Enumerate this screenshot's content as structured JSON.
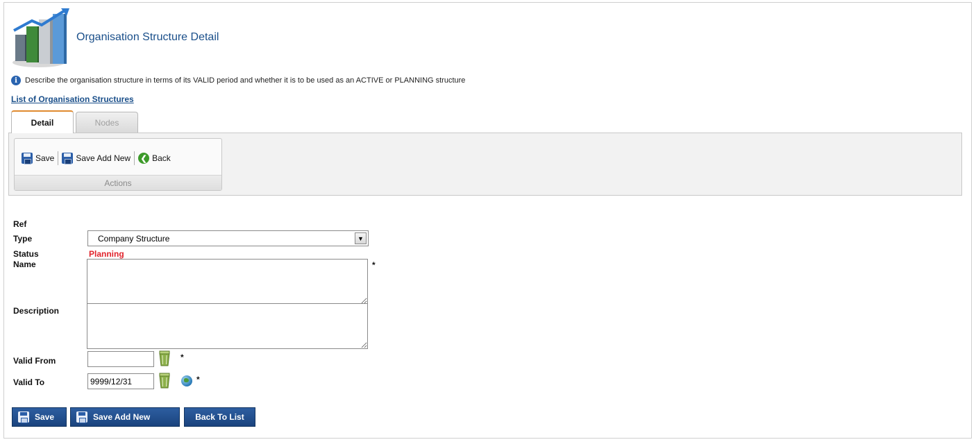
{
  "header": {
    "title": "Organisation Structure Detail",
    "info_text": "Describe the organisation structure in terms of its VALID period and whether it is to be used as an ACTIVE or PLANNING structure",
    "list_link": "List of Organisation Structures"
  },
  "tabs": [
    {
      "label": "Detail",
      "active": true
    },
    {
      "label": "Nodes",
      "active": false
    }
  ],
  "toolbar": {
    "save_label": "Save",
    "save_add_new_label": "Save Add New",
    "back_label": "Back",
    "group_caption": "Actions"
  },
  "form": {
    "ref_label": "Ref",
    "type_label": "Type",
    "type_value": "Company Structure",
    "status_label": "Status",
    "status_value": "Planning",
    "name_label": "Name",
    "name_value": "",
    "required_marker": "*",
    "description_label": "Description",
    "description_value": "",
    "valid_from_label": "Valid From",
    "valid_from_value": "",
    "valid_to_label": "Valid To",
    "valid_to_value": "9999/12/31"
  },
  "bottom_buttons": {
    "save": "Save",
    "save_add_new": "Save Add New",
    "back_to_list": "Back To List"
  },
  "colors": {
    "title": "#1a4f8a",
    "status": "#e0232b",
    "button": "#1a437e",
    "active_tab_accent": "#e08a2e"
  }
}
